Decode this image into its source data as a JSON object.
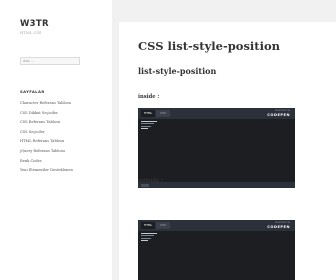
{
  "site": {
    "title": "W3TR",
    "description": "HTML CSS"
  },
  "search": {
    "placeholder": "Ara ..."
  },
  "sidebar": {
    "widget_title": "SAYFALAR",
    "items": [
      {
        "label": "Character Referans Tablosu"
      },
      {
        "label": "CSS Dikkat Seçiciler"
      },
      {
        "label": "CSS Referans Tablosu"
      },
      {
        "label": "CSS Seçiciler"
      },
      {
        "label": "HTML Referans Tablosu"
      },
      {
        "label": "jQuery Referans Tablosu"
      },
      {
        "label": "Renk Codes"
      },
      {
        "label": "Yeni Elementler Desteklenen"
      }
    ]
  },
  "main": {
    "post_title": "CSS list-style-position",
    "subtitle": "list-style-position",
    "examples": [
      {
        "label": "inside :",
        "tab_active": "HTML",
        "tab_inactive": "CSS",
        "meta": "RESULT EDIT ON",
        "logo": "CODEPEN",
        "code_lines": 4
      },
      {
        "label": "outside :",
        "tab_active": "HTML",
        "tab_inactive": "CSS",
        "meta": "RESULT EDIT ON",
        "logo": "CODEPEN",
        "code_lines": 4
      }
    ]
  },
  "colors": {
    "page_bg": "#f1f1f1",
    "card_bg": "#ffffff",
    "pen_bg": "#1d1e22",
    "pen_bar": "#2c303a"
  }
}
